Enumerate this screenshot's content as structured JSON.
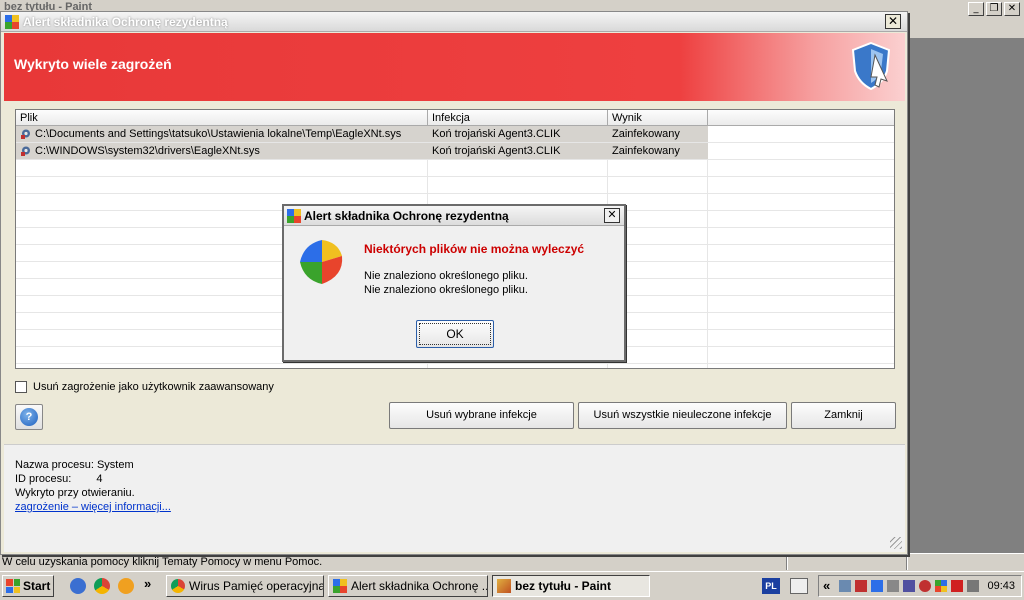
{
  "paint": {
    "title": "bez tytułu - Paint",
    "status_text": "W celu uzyskania pomocy kliknij Tematy Pomocy w menu Pomoc."
  },
  "main_window": {
    "title": "Alert składnika Ochronę rezydentną",
    "header": "Wykryto wiele zagrożeń",
    "columns": [
      "Plik",
      "Infekcja",
      "Wynik"
    ],
    "rows": [
      {
        "file": "C:\\Documents and Settings\\tatsuko\\Ustawienia lokalne\\Temp\\EagleXNt.sys",
        "infection": "Koń trojański Agent3.CLIK",
        "result": "Zainfekowany"
      },
      {
        "file": "C:\\WINDOWS\\system32\\drivers\\EagleXNt.sys",
        "infection": "Koń trojański Agent3.CLIK",
        "result": "Zainfekowany"
      }
    ],
    "advanced_checkbox_label": "Usuń zagrożenie jako użytkownik zaawansowany",
    "buttons": {
      "remove_selected": "Usuń wybrane infekcje",
      "remove_all": "Usuń wszystkie nieuleczone infekcje",
      "close": "Zamknij"
    },
    "process": {
      "name_label": "Nazwa procesu:",
      "name_value": "System",
      "id_label": "ID procesu:",
      "id_value": "4",
      "detected": "Wykryto przy otwieraniu.",
      "more_info_link": "zagrożenie – więcej informacji..."
    }
  },
  "dialog": {
    "title": "Alert składnika Ochronę rezydentną",
    "heading": "Niektórych plików nie można wyleczyć",
    "messages": [
      "Nie znaleziono określonego pliku.",
      "Nie znaleziono określonego pliku."
    ],
    "ok_label": "OK"
  },
  "taskbar": {
    "start_label": "Start",
    "chevron": "»",
    "buttons": [
      {
        "label": "Wirus Pamięć operacyjna..."
      },
      {
        "label": "Alert składnika Ochronę ..."
      },
      {
        "label": "bez tytułu - Paint"
      }
    ],
    "language": "PL",
    "tray_chevron": "«",
    "clock": "09:43"
  },
  "colors": {
    "banner_red": "#e83838",
    "dialog_heading_red": "#cc0000",
    "link_blue": "#0033cc"
  }
}
